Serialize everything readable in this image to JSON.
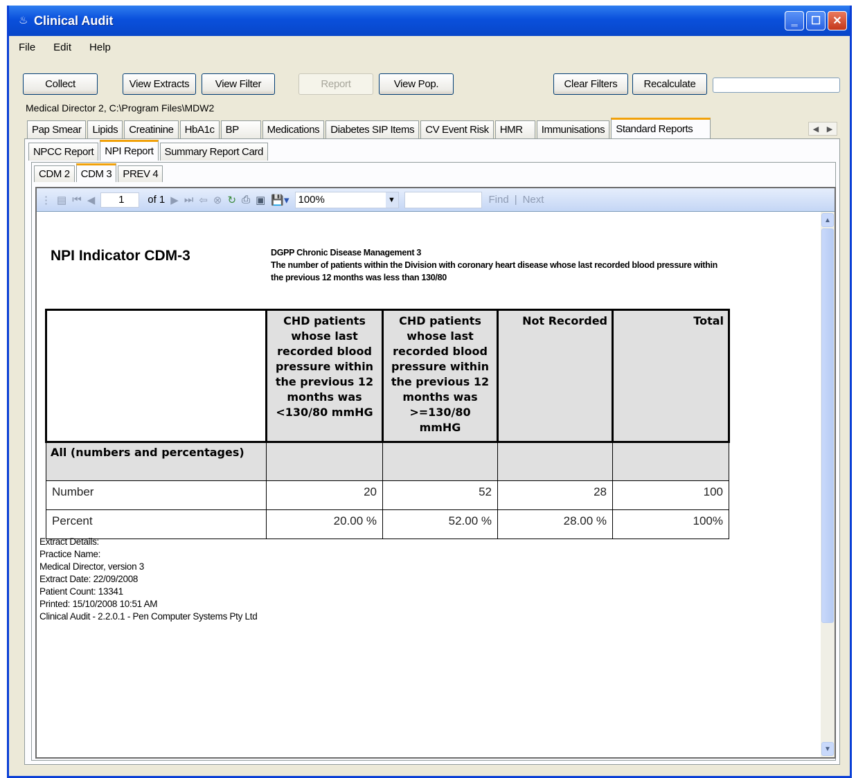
{
  "window": {
    "title": "Clinical Audit"
  },
  "menu": [
    "File",
    "Edit",
    "Help"
  ],
  "buttons": {
    "collect": "Collect",
    "view_extracts": "View Extracts",
    "view_filter": "View Filter",
    "report": "Report",
    "view_pop": "View Pop.",
    "clear_filters": "Clear Filters",
    "recalculate": "Recalculate"
  },
  "data_source": "Medical Director 2, C:\\Program Files\\MDW2",
  "main_tabs": [
    "Pap Smear",
    "Lipids",
    "Creatinine",
    "HbA1c",
    "BP",
    "Medications",
    "Diabetes SIP Items",
    "CV Event Risk",
    "HMR",
    "Immunisations",
    "Standard Reports"
  ],
  "main_tab_active": "Standard Reports",
  "report_tabs": [
    "NPCC Report",
    "NPI Report",
    "Summary Report Card"
  ],
  "report_tab_active": "NPI Report",
  "sub_tabs": [
    "CDM 2",
    "CDM 3",
    "PREV 4"
  ],
  "sub_tab_active": "CDM 3",
  "viewer_toolbar": {
    "page": "1",
    "of_label": "of 1",
    "zoom": "100%",
    "find": "Find",
    "separator": "|",
    "next": "Next"
  },
  "report": {
    "title": "NPI Indicator CDM-3",
    "desc_line1": "DGPP Chronic Disease Management 3",
    "desc_line2": "The number of patients within the Division with coronary heart disease whose last recorded blood pressure within the previous 12 months was less than 130/80",
    "columns": [
      "CHD patients whose last recorded blood pressure within the previous 12 months was <130/80 mmHG",
      "CHD patients whose last recorded blood pressure within the previous 12 months was >=130/80 mmHG",
      "Not Recorded",
      "Total"
    ],
    "group_label": "All (numbers and percentages)",
    "rows": [
      {
        "label": "Number",
        "values": [
          "20",
          "52",
          "28",
          "100"
        ]
      },
      {
        "label": "Percent",
        "values": [
          "20.00 %",
          "52.00 %",
          "28.00 %",
          "100%"
        ]
      }
    ],
    "extract_details": [
      "Extract Details:",
      "Practice Name:",
      "Medical Director, version 3",
      "Extract Date: 22/09/2008",
      "Patient Count: 13341",
      "Printed: 15/10/2008 10:51 AM",
      "Clinical Audit - 2.2.0.1  - Pen Computer Systems Pty Ltd"
    ]
  }
}
